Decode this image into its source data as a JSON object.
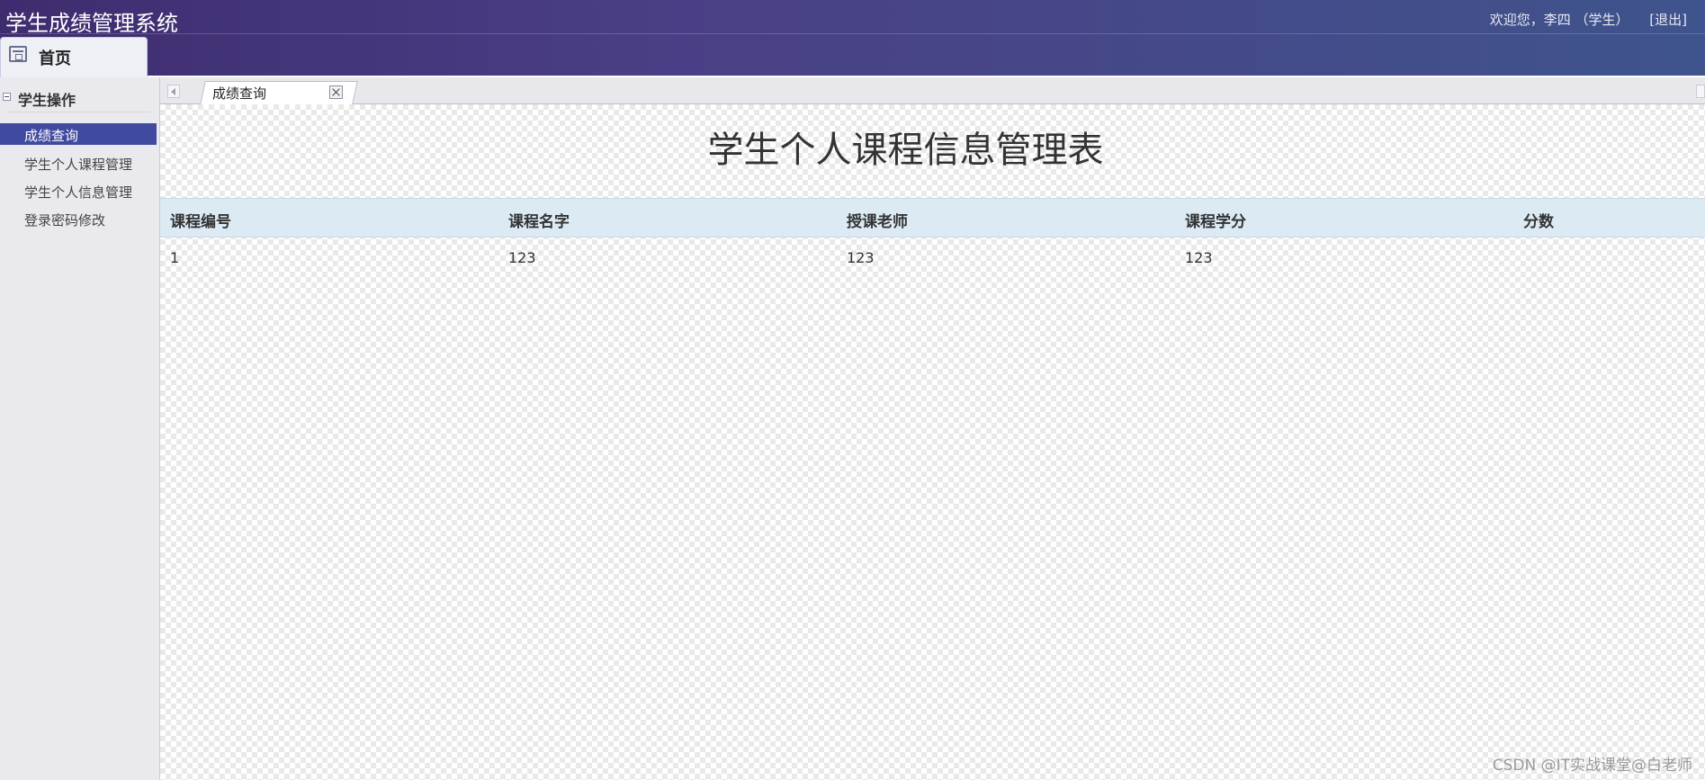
{
  "header": {
    "app_title": "学生成绩管理系统",
    "welcome": "欢迎您，李四 （学生）",
    "logout_label": "[退出]"
  },
  "home_tab": {
    "label": "首页",
    "icon": "home-window-icon"
  },
  "sidebar": {
    "group_label": "学生操作",
    "items": [
      {
        "label": "成绩查询",
        "active": true
      },
      {
        "label": "学生个人课程管理",
        "active": false
      },
      {
        "label": "学生个人信息管理",
        "active": false
      },
      {
        "label": "登录密码修改",
        "active": false
      }
    ]
  },
  "tabs": [
    {
      "label": "成绩查询"
    }
  ],
  "main": {
    "title": "学生个人课程信息管理表",
    "columns": [
      "课程编号",
      "课程名字",
      "授课老师",
      "课程学分",
      "分数"
    ],
    "rows": [
      [
        "1",
        "123",
        "123",
        "123",
        ""
      ]
    ]
  },
  "watermark": "CSDN @IT实战课堂@白老师",
  "colors": {
    "header_start": "#3f2c6f",
    "header_end": "#3f548c",
    "sidebar_active": "#3f4aa0",
    "table_header": "#dceaf4"
  }
}
